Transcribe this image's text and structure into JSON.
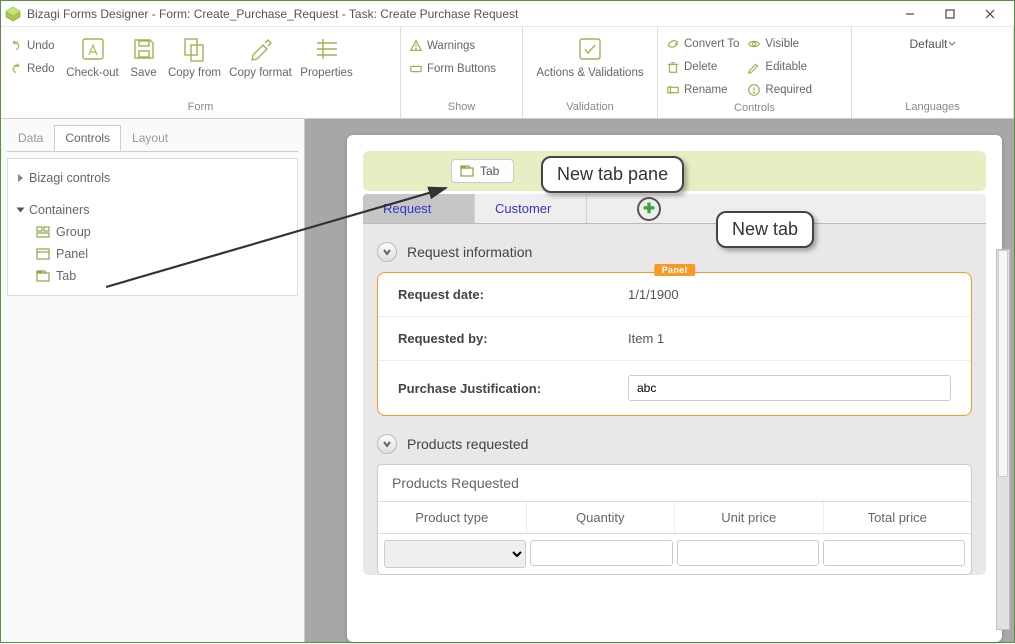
{
  "window": {
    "title": "Bizagi Forms Designer  -  Form: Create_Purchase_Request - Task:  Create Purchase Request"
  },
  "ribbon": {
    "undo": "Undo",
    "redo": "Redo",
    "checkout": "Check-out",
    "save": "Save",
    "copyfrom": "Copy from",
    "copyformat": "Copy format",
    "properties": "Properties",
    "group_form": "Form",
    "warnings": "Warnings",
    "formbuttons": "Form Buttons",
    "group_show": "Show",
    "actions": "Actions & Validations",
    "group_validation": "Validation",
    "convert": "Convert To",
    "delete": "Delete",
    "rename": "Rename",
    "visible": "Visible",
    "editable": "Editable",
    "required": "Required",
    "group_controls": "Controls",
    "default": "Default",
    "group_languages": "Languages"
  },
  "sidebar_tabs": {
    "data": "Data",
    "controls": "Controls",
    "layout": "Layout"
  },
  "tree": {
    "bizagi": "Bizagi controls",
    "containers": "Containers",
    "group": "Group",
    "panel": "Panel",
    "tab": "Tab"
  },
  "canvas": {
    "tab_chip": "Tab",
    "formtab1": "Request",
    "formtab2": "Customer",
    "section1": "Request information",
    "panel_badge": "Panel",
    "fields": {
      "request_date_label": "Request date:",
      "request_date_value": "1/1/1900",
      "requested_by_label": "Requested by:",
      "requested_by_value": "Item 1",
      "justification_label": "Purchase Justification:",
      "justification_value": "abc"
    },
    "section2": "Products requested",
    "grid_title": "Products Requested",
    "cols": {
      "c1": "Product type",
      "c2": "Quantity",
      "c3": "Unit price",
      "c4": "Total price"
    }
  },
  "callouts": {
    "newtabpane": "New tab pane",
    "newtab": "New tab"
  }
}
